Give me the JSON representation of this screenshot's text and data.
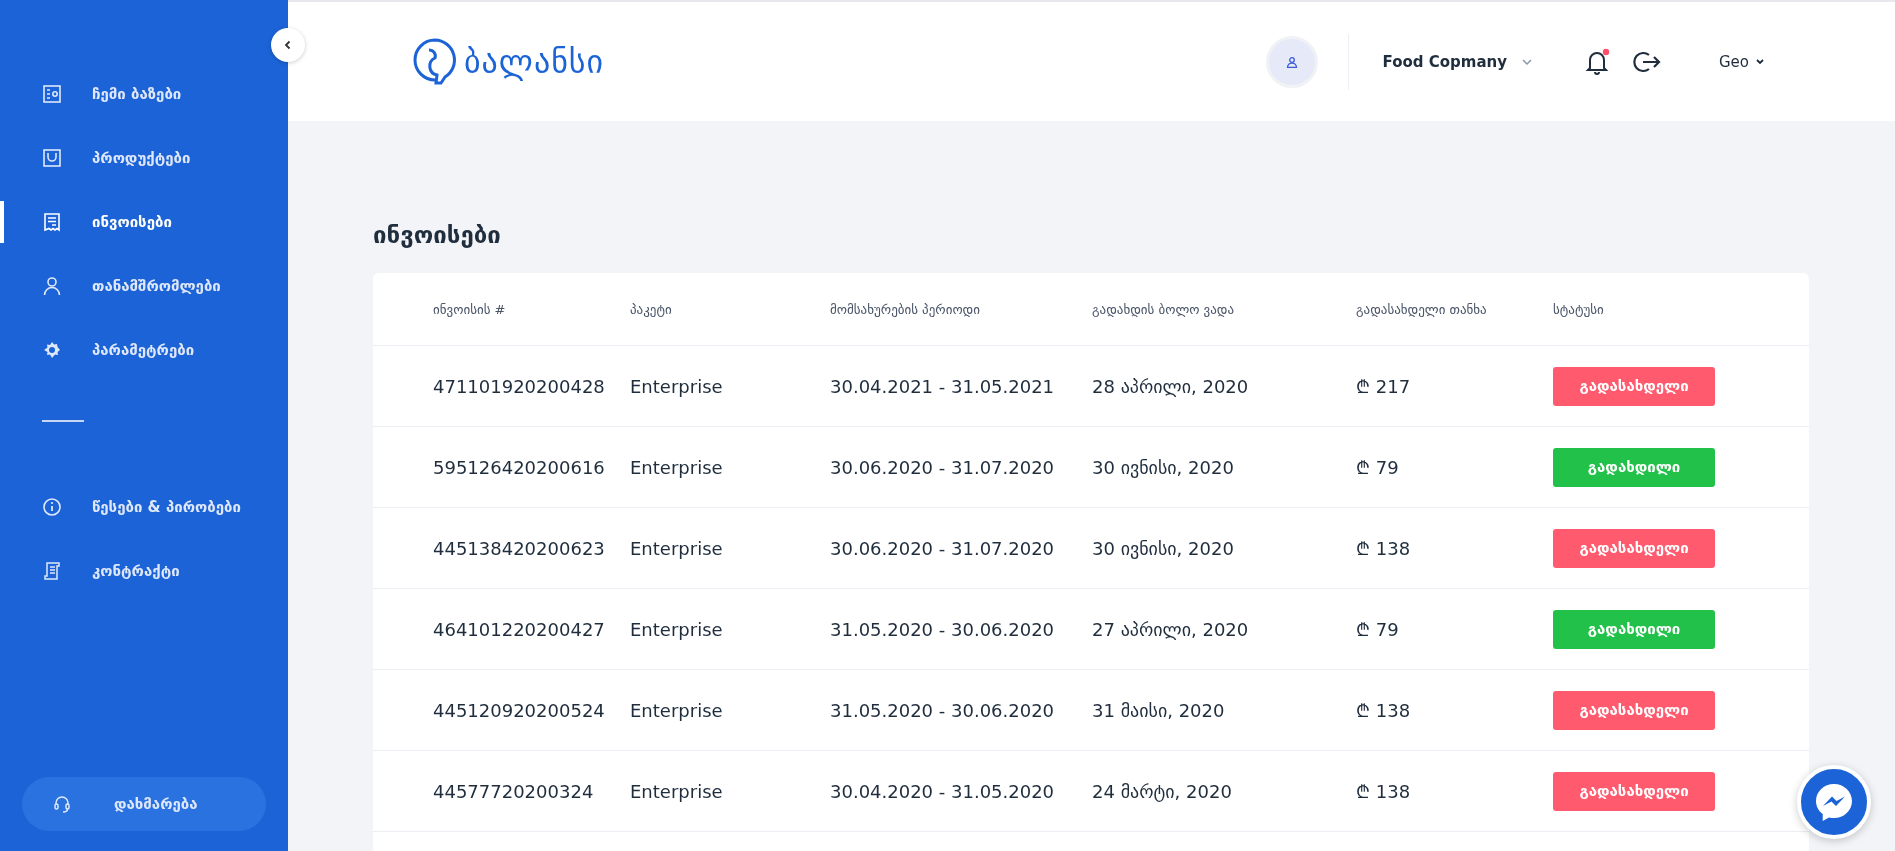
{
  "sidebar": {
    "items": [
      {
        "label": "ჩემი ბაზები",
        "kind": "database",
        "selected": false
      },
      {
        "label": "პროდუქტები",
        "kind": "bag",
        "selected": false
      },
      {
        "label": "ინვოისები",
        "kind": "receipt",
        "selected": true
      },
      {
        "label": "თანამშრომლები",
        "kind": "person",
        "selected": false
      },
      {
        "label": "პარამეტრები",
        "kind": "gear",
        "selected": false
      }
    ],
    "bottom_items": [
      {
        "label": "წესები & პირობები",
        "kind": "info",
        "selected": false
      },
      {
        "label": "კონტრაქტი",
        "kind": "scroll",
        "selected": false
      }
    ],
    "help_button": "დახმარება"
  },
  "header": {
    "logo": "ბალანსი",
    "company": "Food Copmany",
    "language": "Geo",
    "unread_notifications": true
  },
  "page_title": "ინვოისები",
  "table": {
    "columns": [
      "ინვოისის #",
      "პაკეტი",
      "მომსახურების პერიოდი",
      "გადახდის ბოლო ვადა",
      "გადასახდელი თანხა",
      "სტატუსი"
    ],
    "rows": [
      {
        "number": "471101920200428",
        "package": "Enterprise",
        "period": "30.04.2021 - 31.05.2021",
        "due": "28 აპრილი, 2020",
        "amount": "₾ 217",
        "status": "გადასახდელი",
        "kind": "unpaid"
      },
      {
        "number": "595126420200616",
        "package": "Enterprise",
        "period": "30.06.2020 - 31.07.2020",
        "due": "30 ივნისი, 2020",
        "amount": "₾ 79",
        "status": "გადახდილი",
        "kind": "paid"
      },
      {
        "number": "445138420200623",
        "package": "Enterprise",
        "period": "30.06.2020 - 31.07.2020",
        "due": "30 ივნისი, 2020",
        "amount": "₾ 138",
        "status": "გადასახდელი",
        "kind": "unpaid"
      },
      {
        "number": "464101220200427",
        "package": "Enterprise",
        "period": "31.05.2020 - 30.06.2020",
        "due": "27 აპრილი, 2020",
        "amount": "₾ 79",
        "status": "გადახდილი",
        "kind": "paid"
      },
      {
        "number": "445120920200524",
        "package": "Enterprise",
        "period": "31.05.2020 - 30.06.2020",
        "due": "31 მაისი, 2020",
        "amount": "₾ 138",
        "status": "გადასახდელი",
        "kind": "unpaid"
      },
      {
        "number": "44577720200324",
        "package": "Enterprise",
        "period": "30.04.2020 - 31.05.2020",
        "due": "24 მარტი, 2020",
        "amount": "₾ 138",
        "status": "გადასახდელი",
        "kind": "unpaid"
      }
    ]
  }
}
